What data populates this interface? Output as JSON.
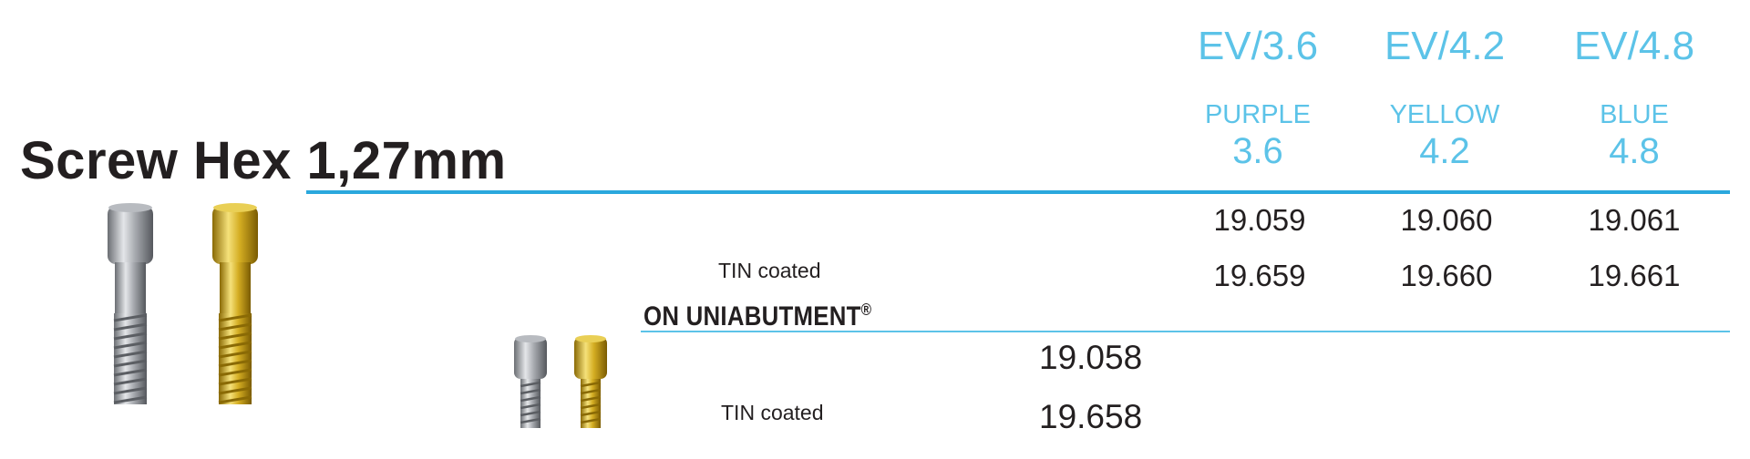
{
  "columns": [
    {
      "size": "EV/3.6",
      "color": "PURPLE",
      "diameter": "3.6"
    },
    {
      "size": "EV/4.2",
      "color": "YELLOW",
      "diameter": "4.2"
    },
    {
      "size": "EV/4.8",
      "color": "BLUE",
      "diameter": "4.8"
    }
  ],
  "title": "Screw Hex 1,27mm",
  "rows": [
    {
      "label": "",
      "codes": [
        "19.059",
        "19.060",
        "19.061"
      ]
    },
    {
      "label": "TIN coated",
      "codes": [
        "19.659",
        "19.660",
        "19.661"
      ]
    }
  ],
  "uniabutment": {
    "title": "ON UNIABUTMENT",
    "title_mark": "®",
    "rows": [
      {
        "label": "",
        "code": "19.058"
      },
      {
        "label": "TIN coated",
        "code": "19.658"
      }
    ]
  },
  "colors": {
    "accent": "#5cc3e8",
    "rule": "#2aa8dd",
    "text": "#231f20"
  },
  "images": [
    "screw-titanium",
    "screw-gold-tin-coated",
    "small-screw-titanium",
    "small-screw-gold-tin-coated"
  ]
}
